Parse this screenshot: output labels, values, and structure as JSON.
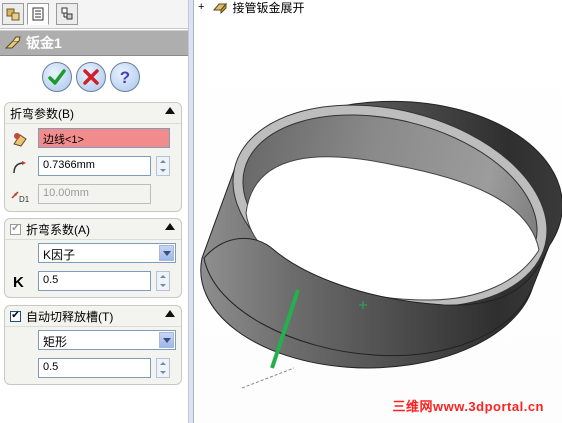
{
  "panel": {
    "title": "钣金1",
    "confirm_buttons": {
      "ok_icon": "green-check-icon",
      "cancel_icon": "red-x-icon",
      "help_icon": "help-question-icon"
    },
    "bend_params": {
      "header": "折弯参数(B)",
      "edge_value": "边线<1>",
      "radius_value": "0.7366mm",
      "disabled_value": "10.00mm"
    },
    "bend_allowance": {
      "header": "折弯系数(A)",
      "checked": true,
      "type_value": "K因子",
      "k_label": "K",
      "k_value": "0.5"
    },
    "auto_relief": {
      "header": "自动切释放槽(T)",
      "checked": true,
      "type_value": "矩形",
      "ratio_value": "0.5"
    }
  },
  "tree": {
    "expand_symbol": "+",
    "item_label": "接管钣金展开"
  },
  "watermark": "三维网www.3dportal.cn",
  "colors": {
    "selected_field": "#f28c8c",
    "title_bar": "#aeaeae",
    "edge_highlight": "#22b14c"
  }
}
